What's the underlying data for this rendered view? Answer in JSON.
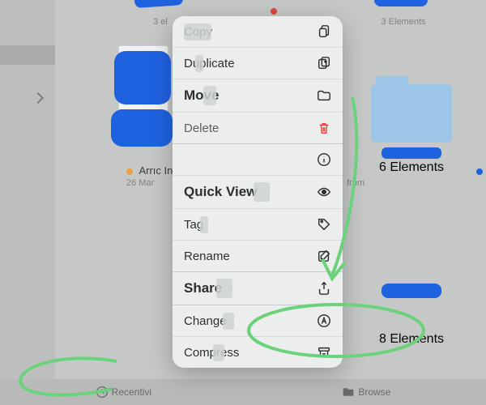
{
  "grid": {
    "top_left_sub": "3 el",
    "top_right_sub": "3 Elements"
  },
  "selected_item": {
    "name": "Arrıc Info",
    "date": "26 Mar",
    "size_hint": "8"
  },
  "menu": {
    "copy": "Copy",
    "duplicate": "Duplicate",
    "move": "Move",
    "delete": "Delete",
    "quicklook": "Quick View",
    "tag": "Tag",
    "rename": "Rename",
    "share": "Share",
    "change": "Change",
    "compress": "Compress"
  },
  "right_text": {
    "from": "from",
    "folder_sub": "6 Elements",
    "bottom_count": "8 Elements"
  },
  "tabs": {
    "recent": "Recentivi",
    "browse": "Browse"
  },
  "colors": {
    "accent_blue": "#1f62e0",
    "delete_red": "#e0473e",
    "folder": "#9cc5e7",
    "annotate": "#6bd17b"
  }
}
